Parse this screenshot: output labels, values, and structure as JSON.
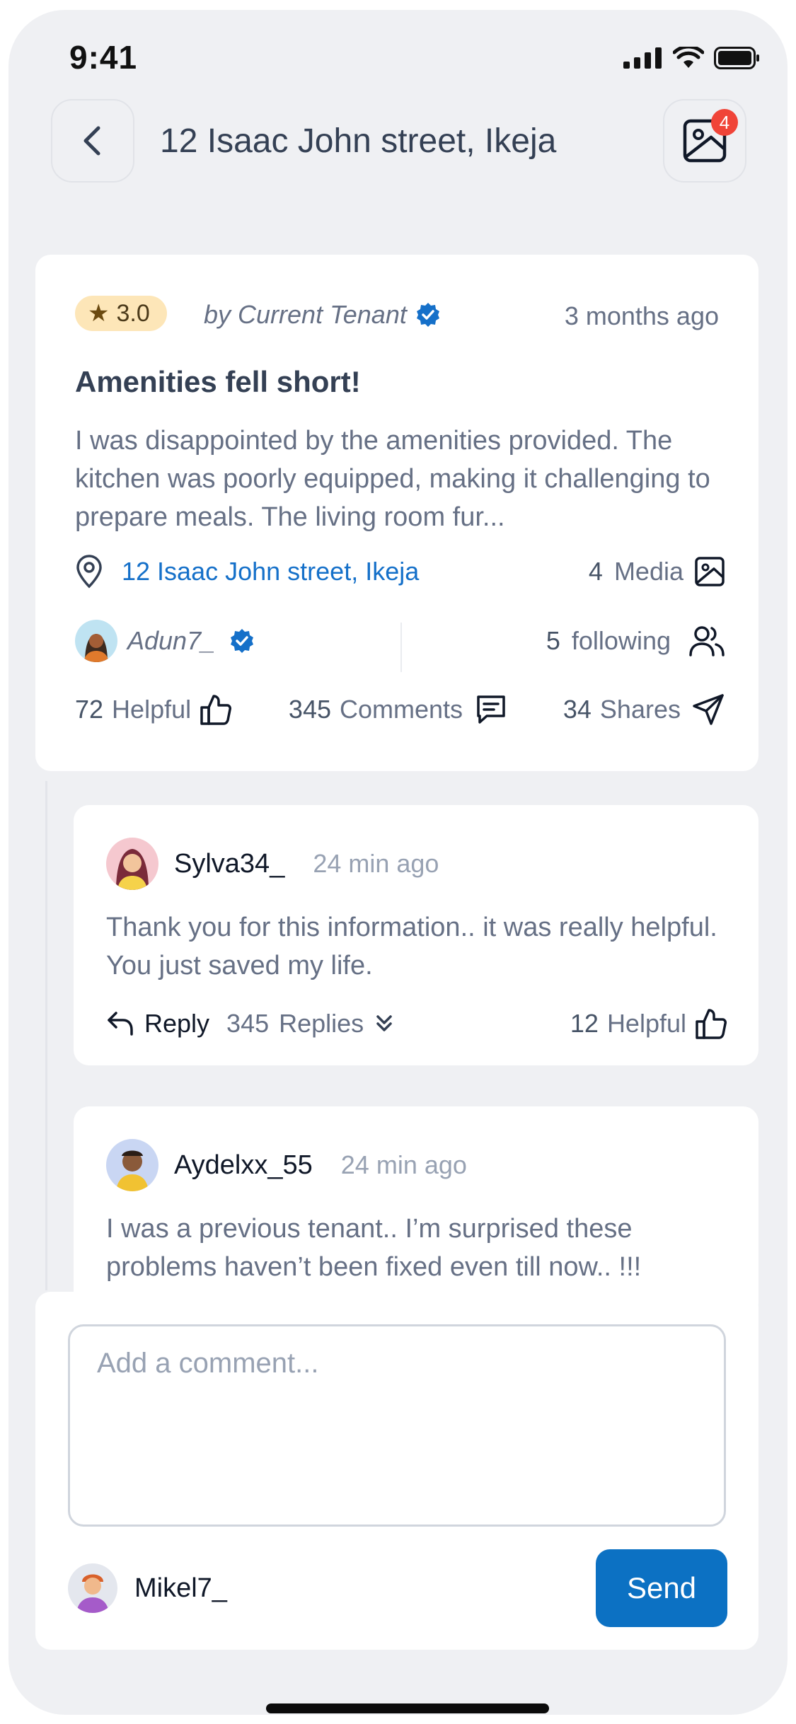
{
  "status_bar": {
    "time": "9:41"
  },
  "header": {
    "title": "12 Isaac John street, Ikeja",
    "media_badge_count": "4",
    "icons": {
      "back": "chevron-left-icon",
      "gallery": "image-icon"
    }
  },
  "review": {
    "rating": "3.0",
    "byline": "by Current Tenant",
    "time_ago": "3 months ago",
    "title": "Amenities fell short!",
    "body": "I was disappointed by the amenities provided. The kitchen was poorly equipped, making it challenging to prepare meals. The living room fur...",
    "location": "12 Isaac John street, Ikeja",
    "media_count": "4",
    "media_label": "Media",
    "author": "Adun7_",
    "following_count": "5",
    "following_label": "following",
    "helpful_count": "72",
    "helpful_label": "Helpful",
    "comments_count": "345",
    "comments_label": "Comments",
    "shares_count": "34",
    "shares_label": "Shares",
    "colors": {
      "link": "#1570c9",
      "rating_pill": "#fde6b8",
      "verified": "#1570c9"
    }
  },
  "comments": [
    {
      "user": "Sylva34_",
      "time": "24 min ago",
      "body": "Thank you for this information.. it was really helpful. You just saved my life.",
      "reply_label": "Reply",
      "replies_count": "345",
      "replies_label": "Replies",
      "helpful_count": "12",
      "helpful_label": "Helpful"
    },
    {
      "user": "Aydelxx_55",
      "time": "24 min ago",
      "body": "I was a previous tenant.. I’m surprised these problems haven’t been fixed even till now.. !!!"
    }
  ],
  "composer": {
    "placeholder": "Add a comment...",
    "value": "",
    "user": "Mikel7_",
    "send_label": "Send",
    "send_color": "#0c71c3"
  }
}
